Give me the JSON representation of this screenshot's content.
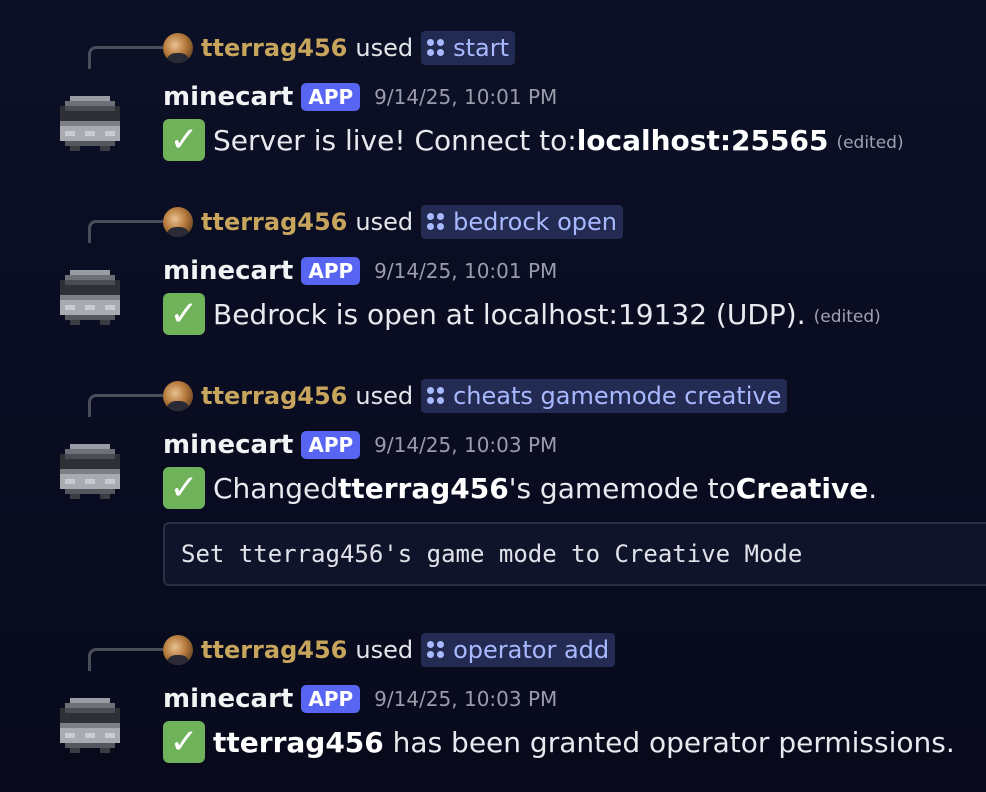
{
  "messages": [
    {
      "reply_user": "tterrag456",
      "reply_used": "used",
      "command": "start",
      "author": "minecart",
      "tag": "APP",
      "timestamp": "9/14/25, 10:01 PM",
      "body_parts": [
        "Server is live! Connect to: ",
        "localhost:25565"
      ],
      "edited": "(edited)"
    },
    {
      "reply_user": "tterrag456",
      "reply_used": "used",
      "command": "bedrock open",
      "author": "minecart",
      "tag": "APP",
      "timestamp": "9/14/25, 10:01 PM",
      "body_text": "Bedrock is open at localhost:19132 (UDP).",
      "edited": "(edited)"
    },
    {
      "reply_user": "tterrag456",
      "reply_used": "used",
      "command": "cheats gamemode creative",
      "author": "minecart",
      "tag": "APP",
      "timestamp": "9/14/25, 10:03 PM",
      "body_parts": [
        "Changed ",
        "tterrag456",
        "'s gamemode to ",
        "Creative",
        "."
      ],
      "code": "Set tterrag456's game mode to Creative Mode"
    },
    {
      "reply_user": "tterrag456",
      "reply_used": "used",
      "command": "operator add",
      "author": "minecart",
      "tag": "APP",
      "timestamp": "9/14/25, 10:03 PM",
      "body_parts": [
        "tterrag456",
        " has been granted operator permissions."
      ]
    }
  ],
  "icons": {
    "check": "check-mark-emoji",
    "command": "slash-command-icon",
    "bot_avatar": "minecart-avatar"
  },
  "colors": {
    "accent": "#5865f2",
    "reply_user": "#c8a55c",
    "command": "#a9b9ff",
    "check": "#6fb25a"
  }
}
